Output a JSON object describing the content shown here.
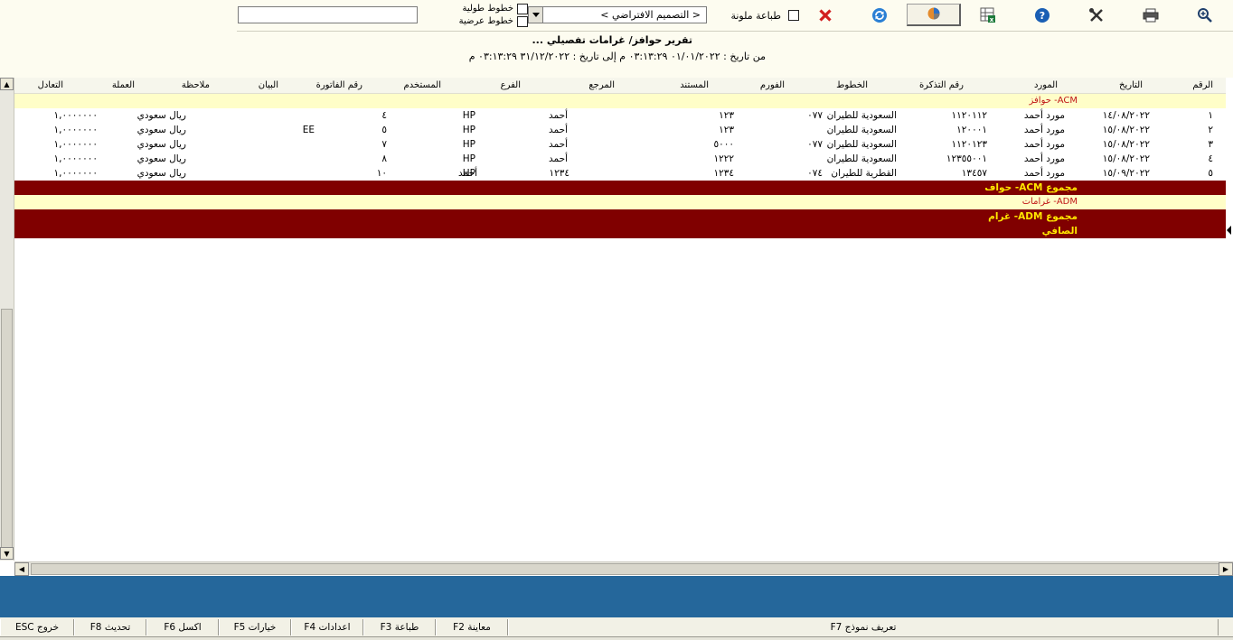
{
  "toolbar": {
    "buttons": [
      {
        "name": "zoom-icon",
        "label": ""
      },
      {
        "name": "print-icon",
        "label": ""
      },
      {
        "name": "tools-icon",
        "label": ""
      },
      {
        "name": "help-icon",
        "label": "?"
      },
      {
        "name": "excel-icon",
        "label": ""
      },
      {
        "name": "chart-cube-icon",
        "label": ""
      },
      {
        "name": "refresh-icon",
        "label": ""
      },
      {
        "name": "close-icon",
        "label": ""
      }
    ],
    "color_print_label": "طباعة ملونة",
    "design_select_value": "< التصميم الافتراضي >",
    "vertical_lines_label": "خطوط طولية",
    "horizontal_lines_label": "خطوط عرضية",
    "search_value": ""
  },
  "report": {
    "title": "تقرير حوافز/ غرامات تفصيلي ...",
    "range": "من تاريخ : ٠١/٠١/٢٠٢٢ ٠٣:١٣:٢٩ م إلى تاريخ : ٣١/١٢/٢٠٢٢ ٠٣:١٣:٢٩ م"
  },
  "grid": {
    "columns": [
      "الرقم",
      "التاريخ",
      "المورد",
      "رقم التذكرة",
      "الخطوط",
      "الفورم",
      "المستند",
      "المرجع",
      "الفرع",
      "المستخدم",
      "رقم الفاتورة",
      "البيان",
      "ملاحظة",
      "العملة",
      "التعادل"
    ],
    "groups": [
      {
        "header": "ACM- حوافز",
        "rows": [
          [
            "١",
            "١٤/٠٨/٢٠٢٢",
            "مورد أحمد",
            "١١٢٠١١٢",
            "السعودية للطيران",
            "٠٧٧",
            "١٢٣",
            "",
            "أحمد",
            "HP",
            "٤",
            "",
            "",
            "ريال سعودي",
            "١,٠٠٠٠٠٠٠"
          ],
          [
            "٢",
            "١٥/٠٨/٢٠٢٢",
            "مورد أحمد",
            "١٢٠٠٠١",
            "السعودية للطيران",
            "",
            "١٢٣",
            "",
            "أحمد",
            "HP",
            "٥",
            "EE",
            "",
            "ريال سعودي",
            "١,٠٠٠٠٠٠٠"
          ],
          [
            "٣",
            "١٥/٠٨/٢٠٢٢",
            "مورد أحمد",
            "١١٢٠١٢٣",
            "السعودية للطيران",
            "٠٧٧",
            "٥٠٠٠",
            "",
            "أحمد",
            "HP",
            "٧",
            "",
            "",
            "ريال سعودي",
            "١,٠٠٠٠٠٠٠"
          ],
          [
            "٤",
            "١٥/٠٨/٢٠٢٢",
            "مورد أحمد",
            "١٢٣٥٥٠٠١",
            "السعودية للطيران",
            "",
            "١٢٢٢",
            "",
            "أحمد",
            "HP",
            "٨",
            "",
            "",
            "ريال سعودي",
            "١,٠٠٠٠٠٠٠"
          ],
          [
            "٥",
            "١٥/٠٩/٢٠٢٢",
            "مورد أحمد",
            "١٣٤٥٧",
            "القطرية للطيران",
            "٠٧٤",
            "١٢٣٤",
            "١٢٣٤",
            "أحمد",
            "HP",
            "١٠",
            "",
            "",
            "ريال سعودي",
            "١,٠٠٠٠٠٠٠"
          ]
        ],
        "total": "مجموع ACM- حواف"
      },
      {
        "header": "ADM- غرامات",
        "rows": [],
        "total": "مجموع ADM- غرام"
      }
    ],
    "net_label": "الصافي"
  },
  "fkeys": [
    {
      "key": "ESC",
      "label": "خروج"
    },
    {
      "key": "F8",
      "label": "تحديث"
    },
    {
      "key": "F6",
      "label": "اكسل"
    },
    {
      "key": "F5",
      "label": "خيارات"
    },
    {
      "key": "F4",
      "label": "اعدادات"
    },
    {
      "key": "F3",
      "label": "طباعة"
    },
    {
      "key": "F2",
      "label": "معاينة"
    },
    {
      "key": "F7",
      "label": "تعريف نموذج"
    }
  ],
  "colors": {
    "total_bg": "#800000",
    "total_text": "#ffe600",
    "group_header_bg": "#fffec8",
    "group_header_text": "#c01818",
    "blue_band": "#25679b"
  }
}
